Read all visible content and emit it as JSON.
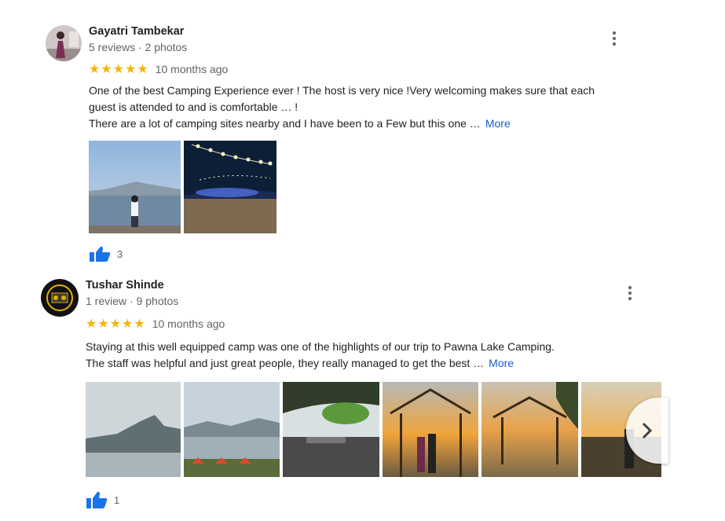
{
  "reviews": [
    {
      "name": "Gayatri Tambekar",
      "meta": "5 reviews · 2 photos",
      "stars": "★★★★★",
      "time": "10 months ago",
      "text_lines": [
        "One of the best Camping Experience ever ! The host is very nice !Very welcoming  makes sure that each",
        "guest is attended to and is comfortable … !",
        "There are a lot of camping sites nearby and I have been to a Few but this one …"
      ],
      "more": "More",
      "likes": "3"
    },
    {
      "name": "Tushar Shinde",
      "meta": "1 review · 9 photos",
      "stars": "★★★★★",
      "time": "10 months ago",
      "text_lines": [
        "Staying at this well equipped camp was one of the highlights of our trip to Pawna Lake Camping.",
        "The staff was helpful and just great people, they really managed to get the best …"
      ],
      "more": "More",
      "likes": "1"
    }
  ],
  "icons": {
    "star": "★",
    "thumbs_up": "thumbs-up-icon",
    "menu": "more-vert-icon",
    "next": "chevron-right-icon"
  },
  "colors": {
    "star": "#f5b400",
    "link": "#1a5ecf",
    "like": "#1a73e8"
  }
}
